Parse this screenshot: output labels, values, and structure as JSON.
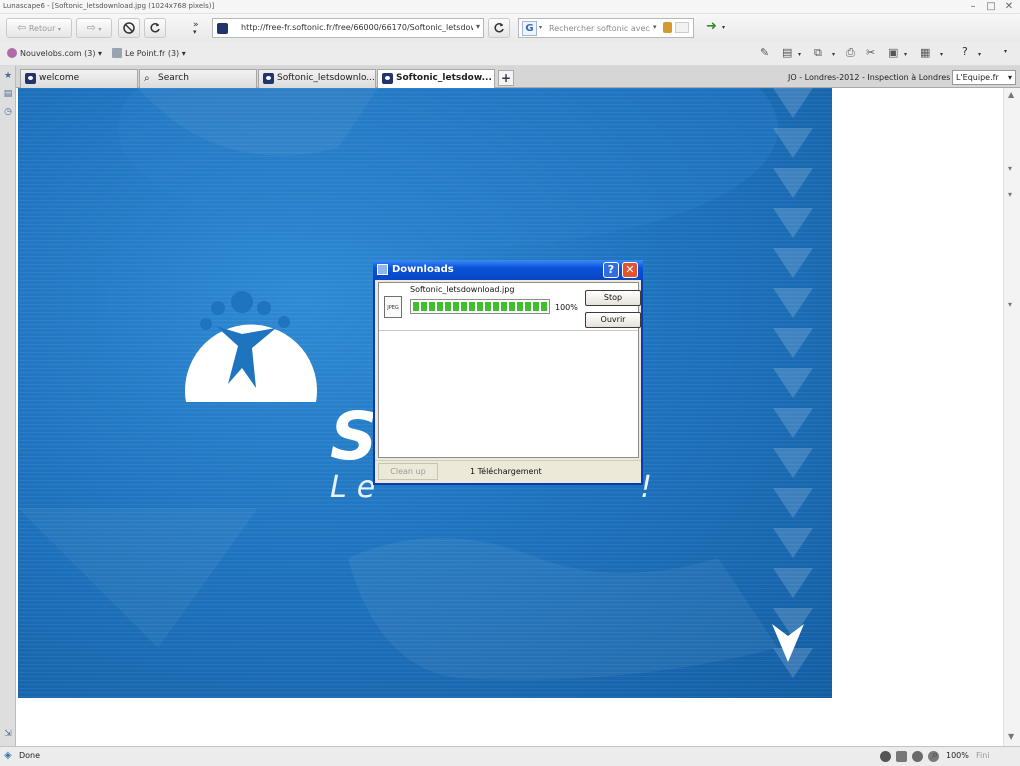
{
  "window": {
    "title": "Lunascape6 - [Softonic_letsdownload.jpg (1024x768 pixels)]"
  },
  "navbar": {
    "back_label": "Retour",
    "url": "http://free-fr.softonic.fr/free/66000/66170/Softonic_letsdown",
    "search_placeholder": "Rechercher softonic avec",
    "search_engine_letter": "G"
  },
  "bookmarks": [
    {
      "label": "Nouvelobs.com (3)"
    },
    {
      "label": "Le Point.fr (3)"
    }
  ],
  "tabs": [
    {
      "label": "welcome",
      "active": false
    },
    {
      "label": "Search",
      "active": false
    },
    {
      "label": "Softonic_letsdownlo...",
      "active": false
    },
    {
      "label": "Softonic_letsdow...",
      "active": true
    }
  ],
  "tab_info": "JO - Londres-2012 - Inspection à Londres",
  "tab_select_value": "L'Equipe.fr",
  "hero": {
    "wordmark_visible": "S",
    "tagline_visible": "Le",
    "tagline_end": "!"
  },
  "downloads": {
    "title": "Downloads",
    "file_name": "Softonic_letsdownload.jpg",
    "file_icon_label": "JPEG",
    "progress_percent": 100,
    "progress_label": "100%",
    "stop_label": "Stop",
    "open_label": "Ouvrir",
    "cleanup_label": "Clean up",
    "count_label": "1 Téléchargement",
    "help_label": "?",
    "close_label": "✕"
  },
  "status": {
    "text": "Done",
    "zoom": "100%",
    "fini": "Fini"
  },
  "colors": {
    "hero_blue": "#1f74bf",
    "xp_title_blue": "#0a52d8",
    "progress_green": "#3fbf2b",
    "close_red": "#e2542f"
  }
}
